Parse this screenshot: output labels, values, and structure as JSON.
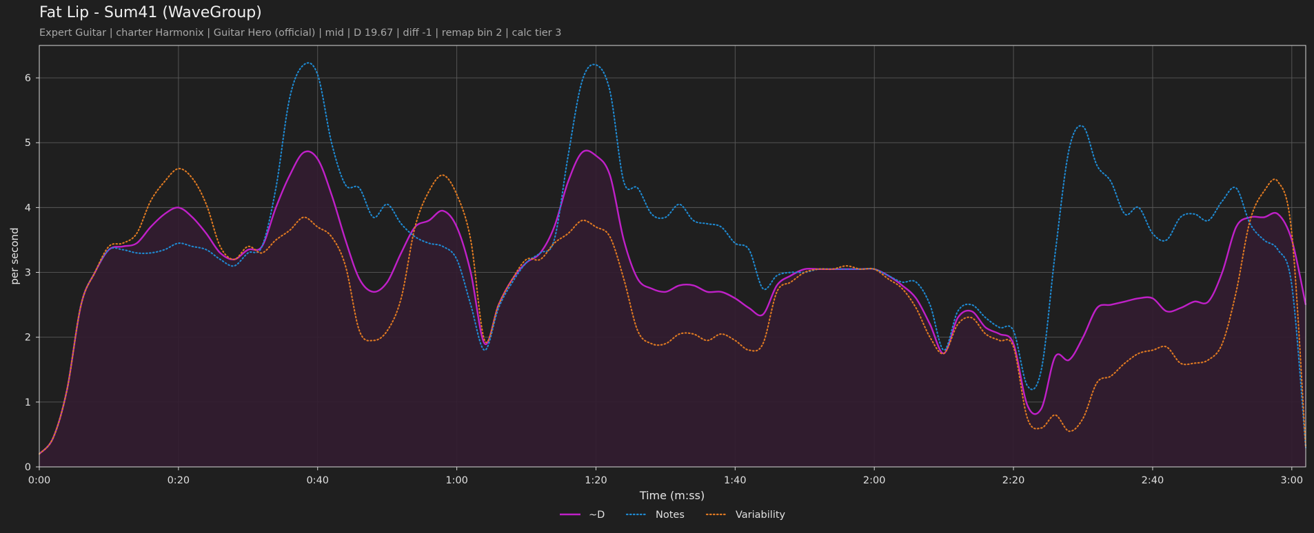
{
  "chart_data": {
    "type": "line",
    "title": "Fat Lip - Sum41 (WaveGroup)",
    "subtitle": "Expert Guitar  |  charter Harmonix  |  Guitar Hero (official)  |  mid  |  D 19.67  |  diff -1  |  remap bin 2  |  calc tier 3",
    "xlabel": "Time (m:ss)",
    "ylabel": "per second",
    "xlim": [
      "0:00",
      "3:02"
    ],
    "ylim": [
      0,
      6.5
    ],
    "x_ticks": [
      "0:00",
      "0:20",
      "0:40",
      "1:00",
      "1:20",
      "1:40",
      "2:00",
      "2:20",
      "2:40",
      "3:00"
    ],
    "y_ticks": [
      0,
      1,
      2,
      3,
      4,
      5,
      6
    ],
    "grid": true,
    "legend": {
      "placement": "bottom-center"
    },
    "colors": {
      "d": "#c020c8",
      "notes": "#1f8ad2",
      "variability": "#e07a22",
      "fill": "#321c30",
      "background": "#1f1f1f"
    },
    "x": [
      "0:00",
      "0:02",
      "0:04",
      "0:06",
      "0:08",
      "0:10",
      "0:12",
      "0:14",
      "0:16",
      "0:18",
      "0:20",
      "0:22",
      "0:24",
      "0:26",
      "0:28",
      "0:30",
      "0:32",
      "0:34",
      "0:36",
      "0:38",
      "0:40",
      "0:42",
      "0:44",
      "0:46",
      "0:48",
      "0:50",
      "0:52",
      "0:54",
      "0:56",
      "0:58",
      "1:00",
      "1:02",
      "1:04",
      "1:06",
      "1:08",
      "1:10",
      "1:12",
      "1:14",
      "1:16",
      "1:18",
      "1:20",
      "1:22",
      "1:24",
      "1:26",
      "1:28",
      "1:30",
      "1:32",
      "1:34",
      "1:36",
      "1:38",
      "1:40",
      "1:42",
      "1:44",
      "1:46",
      "1:48",
      "1:50",
      "1:52",
      "1:54",
      "1:56",
      "1:58",
      "2:00",
      "2:02",
      "2:04",
      "2:06",
      "2:08",
      "2:10",
      "2:12",
      "2:14",
      "2:16",
      "2:18",
      "2:20",
      "2:22",
      "2:24",
      "2:26",
      "2:28",
      "2:30",
      "2:32",
      "2:34",
      "2:36",
      "2:38",
      "2:40",
      "2:42",
      "2:44",
      "2:46",
      "2:48",
      "2:50",
      "2:52",
      "2:54",
      "2:56",
      "2:58",
      "3:00",
      "3:02"
    ],
    "series": [
      {
        "name": "~D",
        "values": [
          0.2,
          0.45,
          1.2,
          2.5,
          3.0,
          3.35,
          3.4,
          3.45,
          3.7,
          3.9,
          4.0,
          3.85,
          3.6,
          3.3,
          3.2,
          3.35,
          3.4,
          4.0,
          4.5,
          4.85,
          4.75,
          4.2,
          3.5,
          2.9,
          2.7,
          2.85,
          3.3,
          3.7,
          3.8,
          3.95,
          3.7,
          3.0,
          1.9,
          2.5,
          2.9,
          3.15,
          3.3,
          3.7,
          4.4,
          4.85,
          4.8,
          4.5,
          3.5,
          2.9,
          2.75,
          2.7,
          2.8,
          2.8,
          2.7,
          2.7,
          2.6,
          2.45,
          2.35,
          2.8,
          2.95,
          3.05,
          3.05,
          3.05,
          3.05,
          3.05,
          3.05,
          2.95,
          2.8,
          2.6,
          2.2,
          1.75,
          2.3,
          2.4,
          2.15,
          2.05,
          1.9,
          0.95,
          0.9,
          1.7,
          1.65,
          2.0,
          2.45,
          2.5,
          2.55,
          2.6,
          2.6,
          2.4,
          2.45,
          2.55,
          2.55,
          3.0,
          3.7,
          3.85,
          3.85,
          3.9,
          3.5,
          2.5
        ]
      },
      {
        "name": "Notes",
        "values": [
          0.2,
          0.45,
          1.2,
          2.5,
          3.0,
          3.35,
          3.35,
          3.3,
          3.3,
          3.35,
          3.45,
          3.4,
          3.35,
          3.2,
          3.1,
          3.3,
          3.4,
          4.3,
          5.7,
          6.2,
          6.05,
          5.0,
          4.35,
          4.3,
          3.85,
          4.05,
          3.75,
          3.55,
          3.45,
          3.4,
          3.2,
          2.5,
          1.8,
          2.45,
          2.85,
          3.15,
          3.3,
          3.5,
          4.8,
          5.95,
          6.2,
          5.8,
          4.4,
          4.3,
          3.9,
          3.85,
          4.05,
          3.8,
          3.75,
          3.7,
          3.45,
          3.35,
          2.75,
          2.95,
          3.0,
          3.0,
          3.05,
          3.05,
          3.05,
          3.05,
          3.05,
          2.95,
          2.85,
          2.85,
          2.5,
          1.8,
          2.4,
          2.5,
          2.3,
          2.15,
          2.1,
          1.25,
          1.5,
          3.3,
          4.9,
          5.25,
          4.65,
          4.4,
          3.9,
          4.0,
          3.6,
          3.5,
          3.85,
          3.9,
          3.8,
          4.1,
          4.3,
          3.75,
          3.5,
          3.35,
          2.8,
          0.3
        ]
      },
      {
        "name": "Variability",
        "values": [
          0.2,
          0.45,
          1.2,
          2.5,
          3.0,
          3.4,
          3.45,
          3.6,
          4.1,
          4.4,
          4.6,
          4.45,
          4.05,
          3.4,
          3.2,
          3.4,
          3.3,
          3.5,
          3.65,
          3.85,
          3.7,
          3.55,
          3.1,
          2.1,
          1.95,
          2.1,
          2.6,
          3.7,
          4.25,
          4.5,
          4.2,
          3.5,
          1.95,
          2.5,
          2.9,
          3.2,
          3.2,
          3.45,
          3.6,
          3.8,
          3.7,
          3.55,
          2.9,
          2.1,
          1.9,
          1.9,
          2.05,
          2.05,
          1.95,
          2.05,
          1.95,
          1.8,
          1.9,
          2.7,
          2.85,
          3.0,
          3.05,
          3.05,
          3.1,
          3.05,
          3.05,
          2.9,
          2.75,
          2.45,
          2.0,
          1.75,
          2.2,
          2.3,
          2.05,
          1.95,
          1.85,
          0.75,
          0.6,
          0.8,
          0.55,
          0.75,
          1.3,
          1.4,
          1.6,
          1.75,
          1.8,
          1.85,
          1.6,
          1.6,
          1.65,
          1.9,
          2.7,
          3.8,
          4.25,
          4.4,
          3.6,
          0.3
        ]
      }
    ]
  }
}
